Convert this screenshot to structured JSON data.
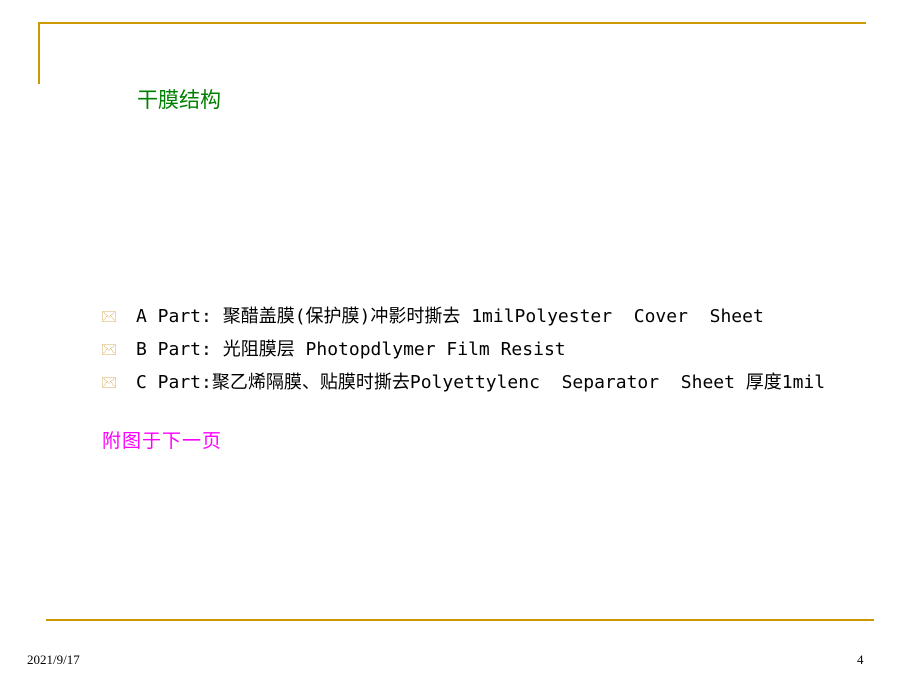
{
  "slide": {
    "title": "干膜结构",
    "bullets": [
      {
        "icon": "envelope-icon",
        "text": "A Part: 聚醋盖膜(保护膜)冲影时撕去 1milPolyester  Cover  Sheet"
      },
      {
        "icon": "envelope-icon",
        "text": "B Part: 光阻膜层 Photopdlymer Film Resist"
      },
      {
        "icon": "envelope-icon",
        "text": "C Part:聚乙烯隔膜、贴膜时撕去Polyettylenc  Separator  Sheet 厚度1mil"
      }
    ],
    "note": "附图于下一页",
    "accent_color": "#cc9900",
    "title_color": "#008000",
    "note_color": "#ff00ff"
  },
  "footer": {
    "date": "2021/9/17",
    "page_number": "4"
  }
}
